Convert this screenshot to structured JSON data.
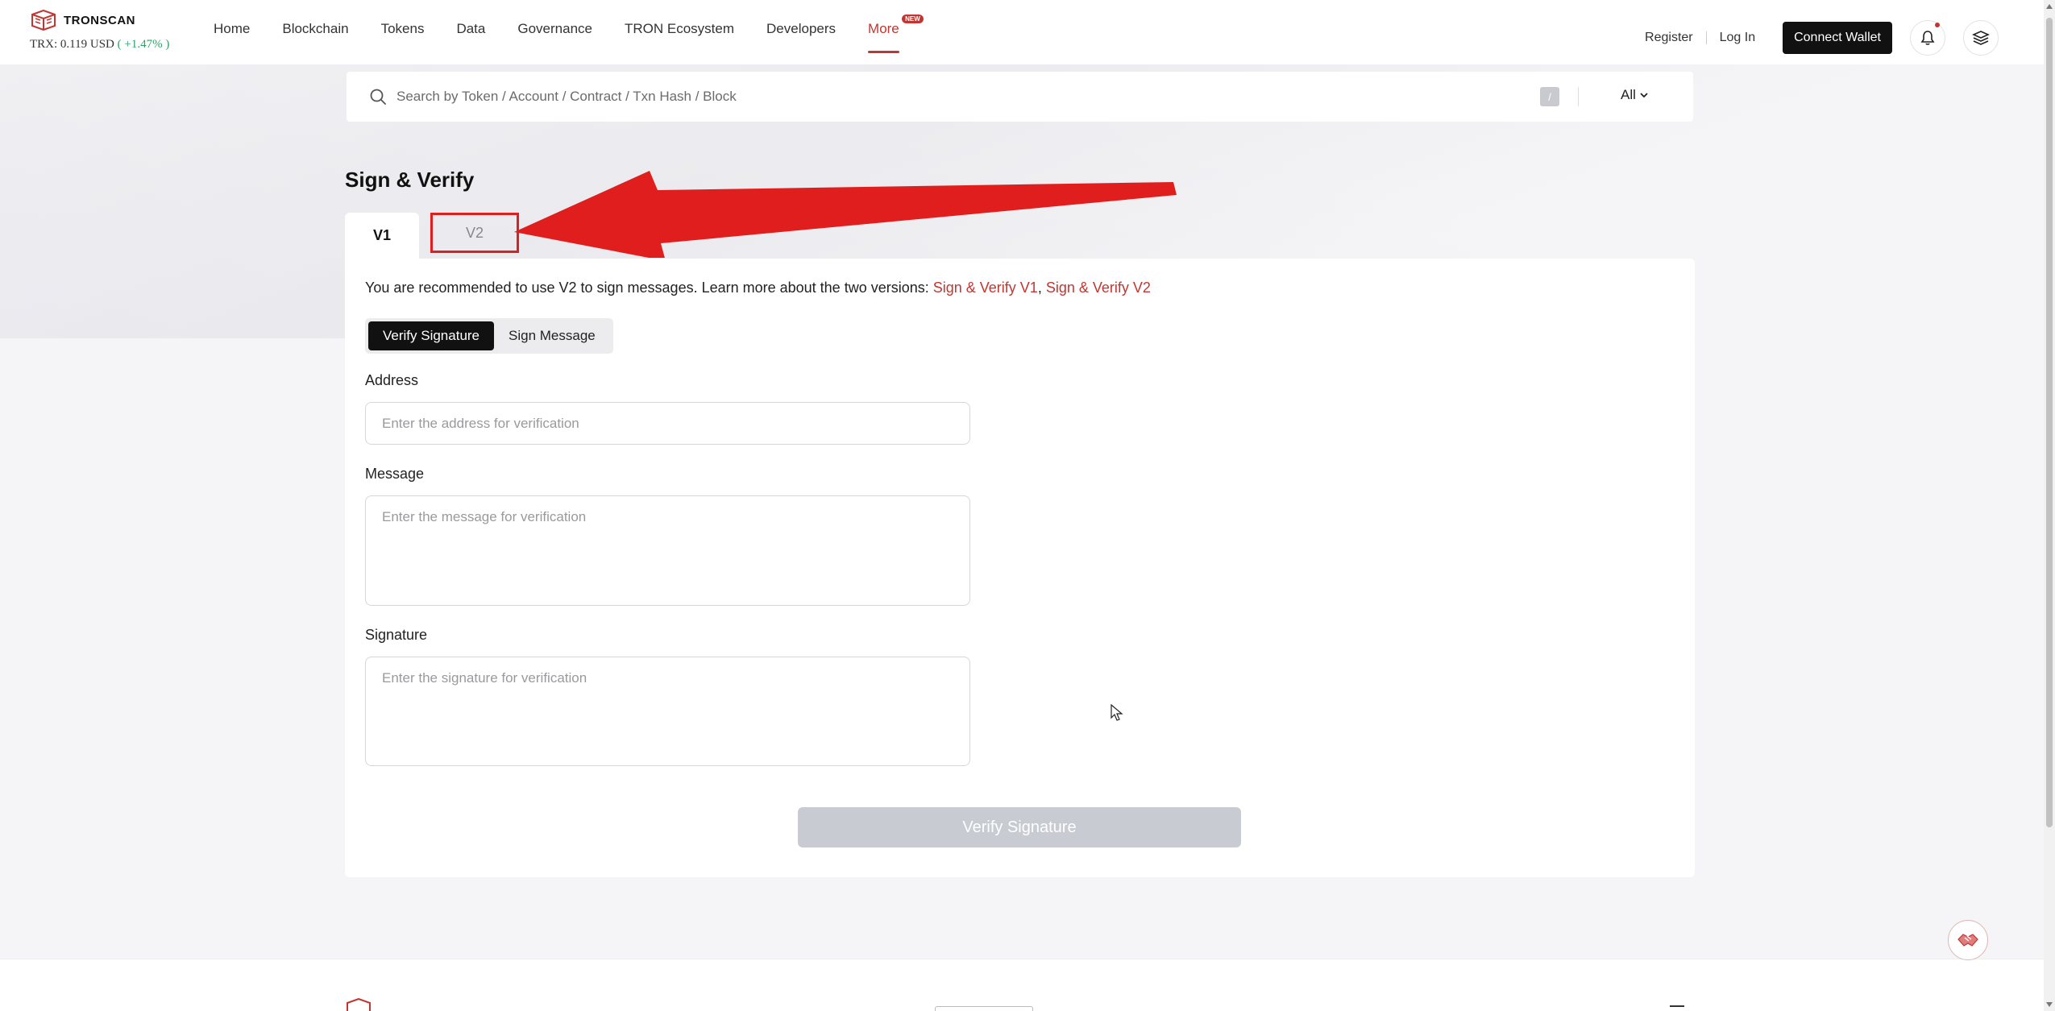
{
  "header": {
    "brand": "TRONSCAN",
    "price_label": "TRX: 0.119 USD",
    "price_change": "( +1.47% )",
    "nav": [
      {
        "label": "Home"
      },
      {
        "label": "Blockchain"
      },
      {
        "label": "Tokens"
      },
      {
        "label": "Data"
      },
      {
        "label": "Governance"
      },
      {
        "label": "TRON Ecosystem"
      },
      {
        "label": "Developers"
      },
      {
        "label": "More",
        "badge": "NEW"
      }
    ],
    "register": "Register",
    "login": "Log In",
    "connect_wallet": "Connect Wallet"
  },
  "search": {
    "placeholder": "Search by Token / Account / Contract / Txn Hash / Block",
    "shortcut": "/",
    "filter": "All"
  },
  "page": {
    "title": "Sign & Verify",
    "tabs": [
      {
        "label": "V1"
      },
      {
        "label": "V2"
      }
    ],
    "notice_text": "You are recommended to use V2 to sign messages. Learn more about the two versions: ",
    "link_v1": "Sign & Verify V1",
    "link_separator": ", ",
    "link_v2": "Sign & Verify V2",
    "modes": [
      {
        "label": "Verify Signature"
      },
      {
        "label": "Sign Message"
      }
    ],
    "address_label": "Address",
    "address_placeholder": "Enter the address for verification",
    "message_label": "Message",
    "message_placeholder": "Enter the message for verification",
    "signature_label": "Signature",
    "signature_placeholder": "Enter the signature for verification",
    "submit": "Verify Signature"
  },
  "colors": {
    "brand_red": "#c23631",
    "annotation_red": "#e01e1e",
    "positive_green": "#2aa36b",
    "dark_button": "#111111",
    "disabled_button": "#c8cbd1"
  }
}
